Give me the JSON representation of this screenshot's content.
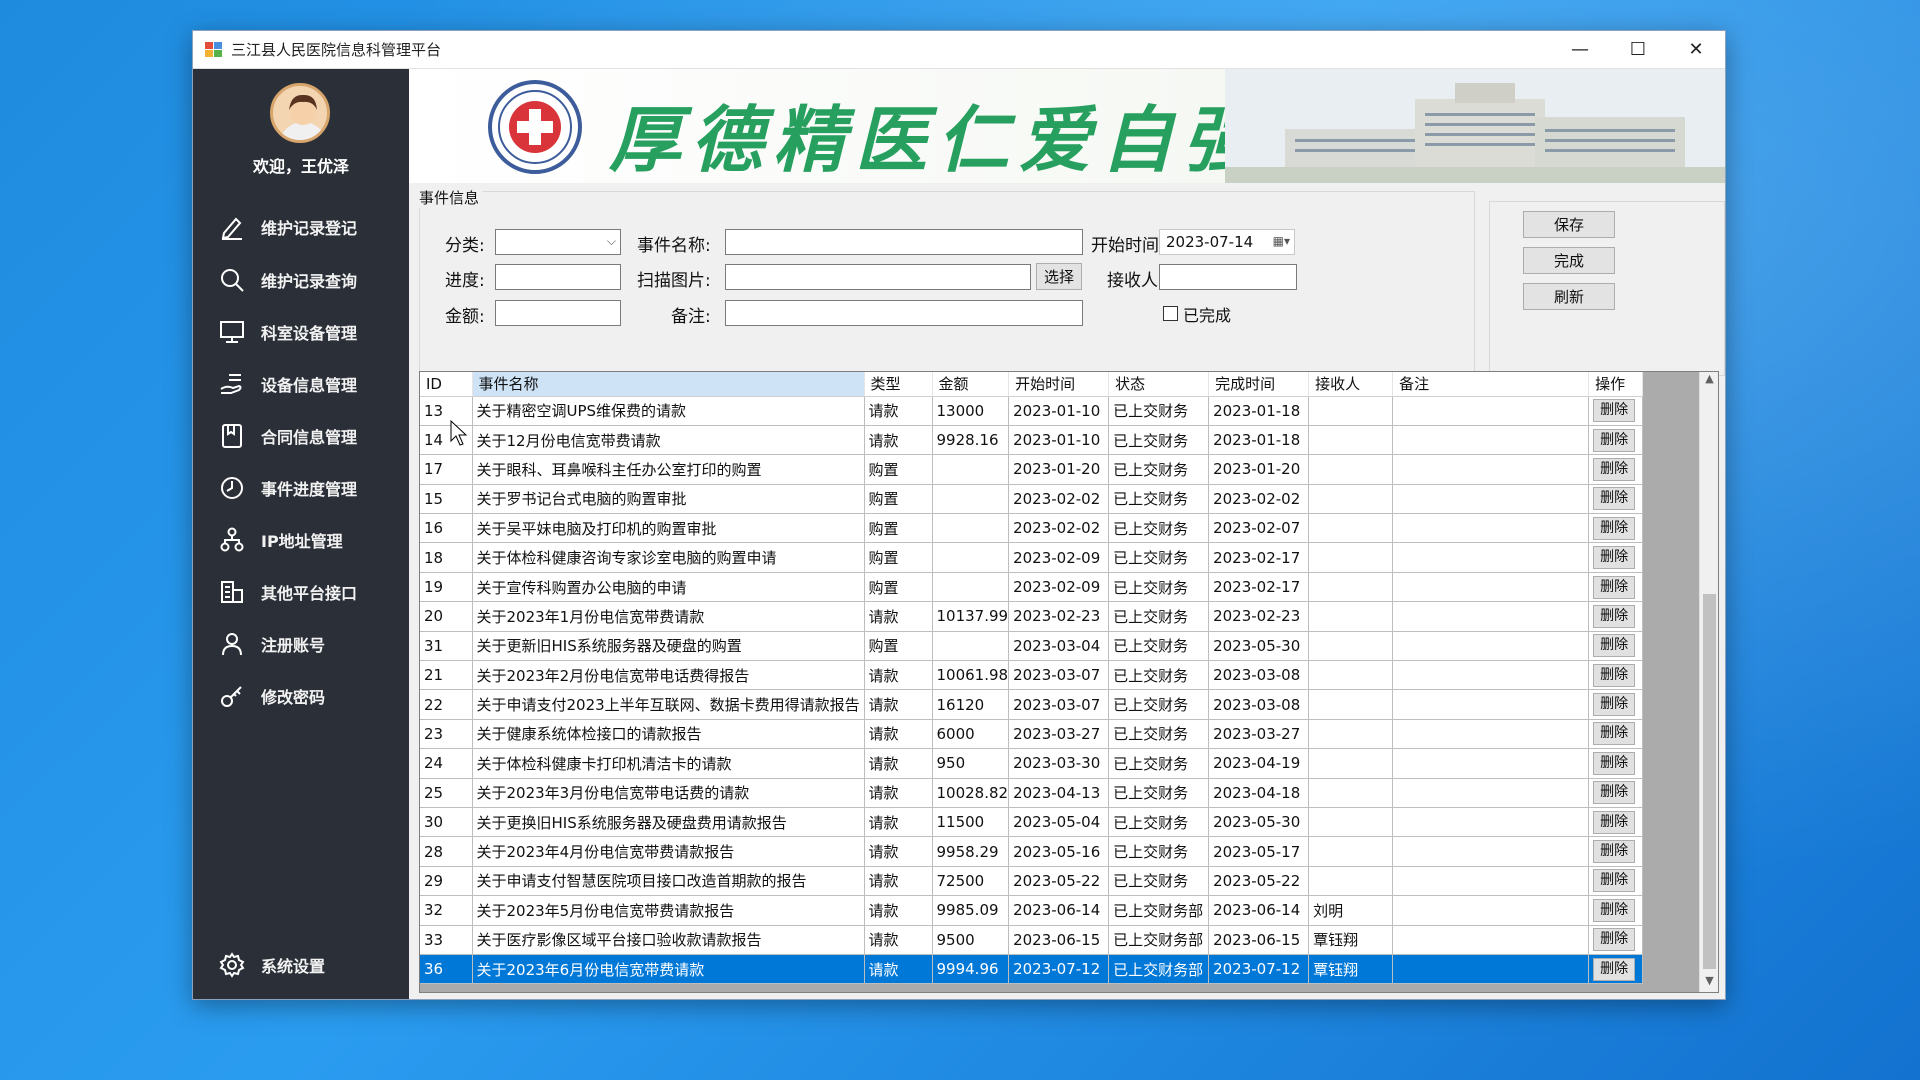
{
  "window": {
    "title": "三江县人民医院信息科管理平台",
    "controls": {
      "minimize": "—",
      "maximize": "☐",
      "close": "✕"
    }
  },
  "sidebar": {
    "welcome": "欢迎，王优泽",
    "items": [
      {
        "label": "维护记录登记",
        "icon": "pencil-icon"
      },
      {
        "label": "维护记录查询",
        "icon": "search-icon"
      },
      {
        "label": "科室设备管理",
        "icon": "monitor-icon"
      },
      {
        "label": "设备信息管理",
        "icon": "hand-stack-icon"
      },
      {
        "label": "合同信息管理",
        "icon": "bookmark-icon"
      },
      {
        "label": "事件进度管理",
        "icon": "clock-icon"
      },
      {
        "label": "IP地址管理",
        "icon": "network-icon"
      },
      {
        "label": "其他平台接口",
        "icon": "building-icon"
      },
      {
        "label": "注册账号",
        "icon": "user-icon"
      },
      {
        "label": "修改密码",
        "icon": "key-icon"
      }
    ],
    "settings_label": "系统设置"
  },
  "banner": {
    "slogan": "厚德精医仁爱自强"
  },
  "event_form": {
    "group_title": "事件信息",
    "category_label": "分类:",
    "category_value": "",
    "event_name_label": "事件名称:",
    "event_name_value": "",
    "start_time_label": "开始时间:",
    "start_time_value": "2023-07-14",
    "progress_label": "进度:",
    "progress_value": "",
    "scan_label": "扫描图片:",
    "scan_value": "",
    "select_button": "选择",
    "receiver_label": "接收人:",
    "receiver_value": "",
    "amount_label": "金额:",
    "amount_value": "",
    "note_label": "备注:",
    "note_value": "",
    "done_checkbox_label": "已完成",
    "done_checked": false
  },
  "actions": {
    "save": "保存",
    "complete": "完成",
    "refresh": "刷新"
  },
  "table": {
    "columns": [
      "ID",
      "事件名称",
      "类型",
      "金额",
      "开始时间",
      "状态",
      "完成时间",
      "接收人",
      "备注",
      "操作"
    ],
    "delete_label": "删除",
    "selected_row_index": 19,
    "rows": [
      [
        "13",
        "关于精密空调UPS维保费的请款",
        "请款",
        "13000",
        "2023-01-10",
        "已上交财务",
        "2023-01-18",
        "",
        ""
      ],
      [
        "14",
        "关于12月份电信宽带费请款",
        "请款",
        "9928.16",
        "2023-01-10",
        "已上交财务",
        "2023-01-18",
        "",
        ""
      ],
      [
        "17",
        "关于眼科、耳鼻喉科主任办公室打印的购置",
        "购置",
        "",
        "2023-01-20",
        "已上交财务",
        "2023-01-20",
        "",
        ""
      ],
      [
        "15",
        "关于罗书记台式电脑的购置审批",
        "购置",
        "",
        "2023-02-02",
        "已上交财务",
        "2023-02-02",
        "",
        ""
      ],
      [
        "16",
        "关于吴平妹电脑及打印机的购置审批",
        "购置",
        "",
        "2023-02-02",
        "已上交财务",
        "2023-02-07",
        "",
        ""
      ],
      [
        "18",
        "关于体检科健康咨询专家诊室电脑的购置申请",
        "购置",
        "",
        "2023-02-09",
        "已上交财务",
        "2023-02-17",
        "",
        ""
      ],
      [
        "19",
        "关于宣传科购置办公电脑的申请",
        "购置",
        "",
        "2023-02-09",
        "已上交财务",
        "2023-02-17",
        "",
        ""
      ],
      [
        "20",
        "关于2023年1月份电信宽带费请款",
        "请款",
        "10137.99",
        "2023-02-23",
        "已上交财务",
        "2023-02-23",
        "",
        ""
      ],
      [
        "31",
        "关于更新旧HIS系统服务器及硬盘的购置",
        "购置",
        "",
        "2023-03-04",
        "已上交财务",
        "2023-05-30",
        "",
        ""
      ],
      [
        "21",
        "关于2023年2月份电信宽带电话费得报告",
        "请款",
        "10061.98",
        "2023-03-07",
        "已上交财务",
        "2023-03-08",
        "",
        ""
      ],
      [
        "22",
        "关于申请支付2023上半年互联网、数据卡费用得请款报告",
        "请款",
        "16120",
        "2023-03-07",
        "已上交财务",
        "2023-03-08",
        "",
        ""
      ],
      [
        "23",
        "关于健康系统体检接口的请款报告",
        "请款",
        "6000",
        "2023-03-27",
        "已上交财务",
        "2023-03-27",
        "",
        ""
      ],
      [
        "24",
        "关于体检科健康卡打印机清洁卡的请款",
        "请款",
        "950",
        "2023-03-30",
        "已上交财务",
        "2023-04-19",
        "",
        ""
      ],
      [
        "25",
        "关于2023年3月份电信宽带电话费的请款",
        "请款",
        "10028.82",
        "2023-04-13",
        "已上交财务",
        "2023-04-18",
        "",
        ""
      ],
      [
        "30",
        "关于更换旧HIS系统服务器及硬盘费用请款报告",
        "请款",
        "11500",
        "2023-05-04",
        "已上交财务",
        "2023-05-30",
        "",
        ""
      ],
      [
        "28",
        "关于2023年4月份电信宽带费请款报告",
        "请款",
        "9958.29",
        "2023-05-16",
        "已上交财务",
        "2023-05-17",
        "",
        ""
      ],
      [
        "29",
        "关于申请支付智慧医院项目接口改造首期款的报告",
        "请款",
        "72500",
        "2023-05-22",
        "已上交财务",
        "2023-05-22",
        "",
        ""
      ],
      [
        "32",
        "关于2023年5月份电信宽带费请款报告",
        "请款",
        "9985.09",
        "2023-06-14",
        "已上交财务部",
        "2023-06-14",
        "刘明",
        ""
      ],
      [
        "33",
        "关于医疗影像区域平台接口验收款请款报告",
        "请款",
        "9500",
        "2023-06-15",
        "已上交财务部",
        "2023-06-15",
        "覃钰翔",
        ""
      ],
      [
        "36",
        "关于2023年6月份电信宽带费请款",
        "请款",
        "9994.96",
        "2023-07-12",
        "已上交财务部",
        "2023-07-12",
        "覃钰翔",
        ""
      ]
    ]
  },
  "colors": {
    "sidebar_bg": "#2b3038",
    "selection": "#0078d7",
    "slogan_green": "#27a05f",
    "desktop": "#1f8bdf"
  }
}
